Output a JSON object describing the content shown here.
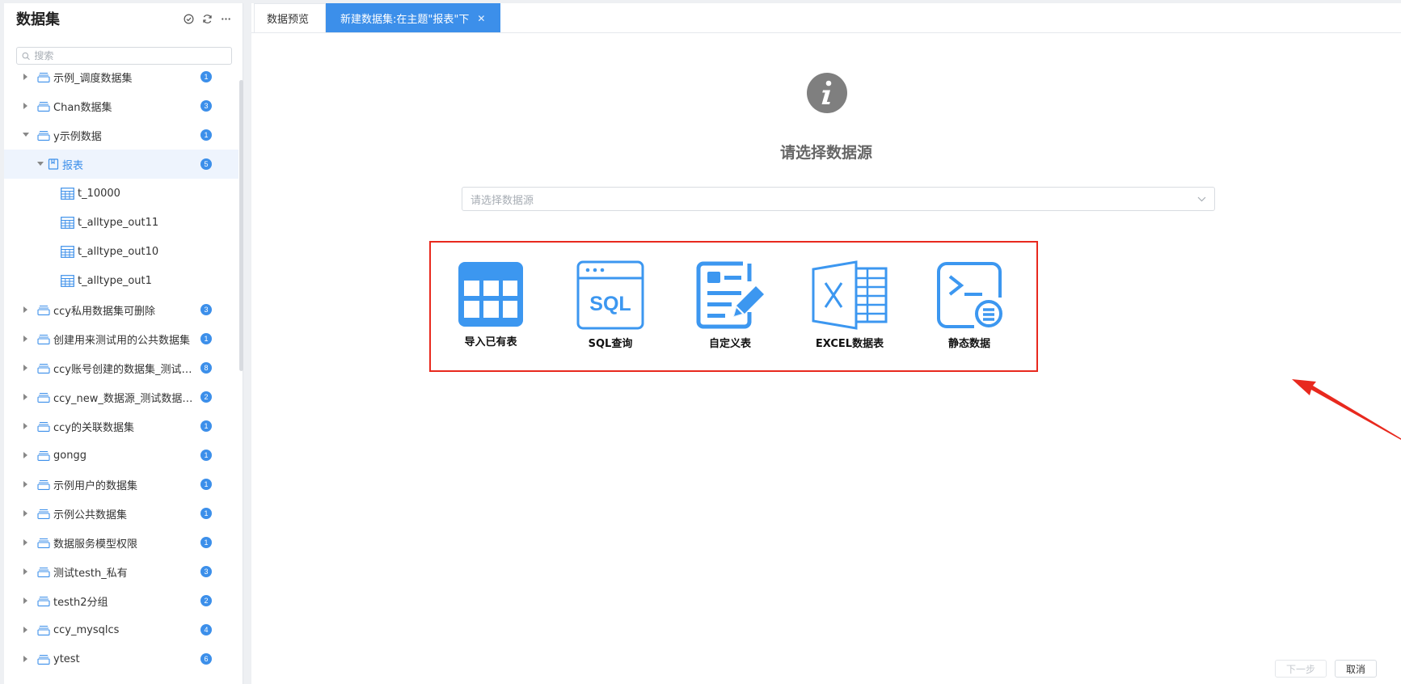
{
  "sidebar": {
    "title": "数据集",
    "search_placeholder": "搜索",
    "items": [
      {
        "label": "示例_调度数据集",
        "count": "1",
        "level": 0,
        "type": "folder",
        "expanded": false
      },
      {
        "label": "Chan数据集",
        "count": "3",
        "level": 0,
        "type": "folder",
        "expanded": false
      },
      {
        "label": "y示例数据",
        "count": "1",
        "level": 0,
        "type": "folder",
        "expanded": true
      },
      {
        "label": "报表",
        "count": "5",
        "level": 1,
        "type": "theme",
        "expanded": true,
        "selected": true
      },
      {
        "label": "t_10000",
        "count": "",
        "level": 2,
        "type": "table"
      },
      {
        "label": "t_alltype_out11",
        "count": "",
        "level": 2,
        "type": "table"
      },
      {
        "label": "t_alltype_out10",
        "count": "",
        "level": 2,
        "type": "table"
      },
      {
        "label": "t_alltype_out1",
        "count": "",
        "level": 2,
        "type": "table"
      },
      {
        "label": "ccy私用数据集可删除",
        "count": "3",
        "level": 0,
        "type": "folder",
        "expanded": false
      },
      {
        "label": "创建用来测试用的公共数据集",
        "count": "1",
        "level": 0,
        "type": "folder",
        "expanded": false
      },
      {
        "label": "ccy账号创建的数据集_测试数据集",
        "count": "8",
        "level": 0,
        "type": "folder",
        "expanded": false
      },
      {
        "label": "ccy_new_数据源_测试数据服务",
        "count": "2",
        "level": 0,
        "type": "folder",
        "expanded": false
      },
      {
        "label": "ccy的关联数据集",
        "count": "1",
        "level": 0,
        "type": "folder",
        "expanded": false
      },
      {
        "label": "gongg",
        "count": "1",
        "level": 0,
        "type": "folder",
        "expanded": false
      },
      {
        "label": "示例用户的数据集",
        "count": "1",
        "level": 0,
        "type": "folder",
        "expanded": false
      },
      {
        "label": "示例公共数据集",
        "count": "1",
        "level": 0,
        "type": "folder",
        "expanded": false
      },
      {
        "label": "数据服务模型权限",
        "count": "1",
        "level": 0,
        "type": "folder",
        "expanded": false
      },
      {
        "label": "测试testh_私有",
        "count": "3",
        "level": 0,
        "type": "folder",
        "expanded": false
      },
      {
        "label": "testh2分组",
        "count": "2",
        "level": 0,
        "type": "folder",
        "expanded": false
      },
      {
        "label": "ccy_mysqlcs",
        "count": "4",
        "level": 0,
        "type": "folder",
        "expanded": false
      },
      {
        "label": "ytest",
        "count": "6",
        "level": 0,
        "type": "folder",
        "expanded": false
      }
    ]
  },
  "tabs": [
    {
      "label": "数据预览",
      "active": false
    },
    {
      "label": "新建数据集:在主题\"报表\"下",
      "active": true
    }
  ],
  "main": {
    "heading": "请选择数据源",
    "select_placeholder": "请选择数据源",
    "sources": [
      {
        "label": "导入已有表",
        "icon": "table-grid-icon"
      },
      {
        "label": "SQL查询",
        "icon": "sql-window-icon"
      },
      {
        "label": "自定义表",
        "icon": "custom-form-icon"
      },
      {
        "label": "EXCEL数据表",
        "icon": "excel-icon"
      },
      {
        "label": "静态数据",
        "icon": "terminal-icon"
      }
    ]
  },
  "footer": {
    "next_label": "下一步",
    "cancel_label": "取消"
  },
  "colors": {
    "accent": "#3c8fea",
    "highlight_box": "#e8291e",
    "info_icon": "#7f7f7f"
  }
}
